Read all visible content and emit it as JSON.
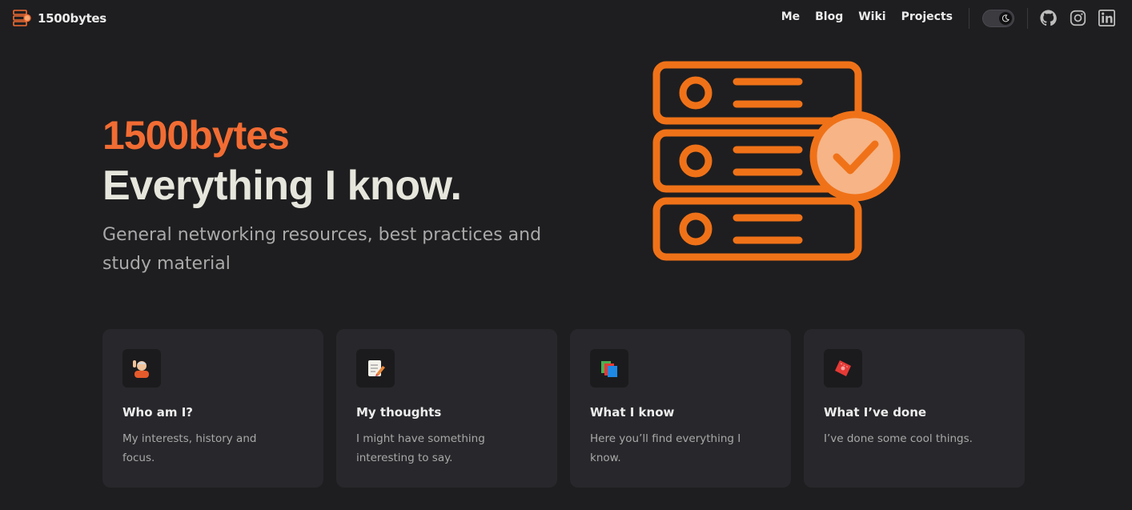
{
  "brand": {
    "name": "1500bytes",
    "accent": "#f26c33",
    "logo_icon": "server-stack-icon"
  },
  "nav": {
    "links": [
      {
        "label": "Me"
      },
      {
        "label": "Blog"
      },
      {
        "label": "Wiki"
      },
      {
        "label": "Projects"
      }
    ],
    "theme_toggle_icon": "moon-icon",
    "social": [
      "github-icon",
      "instagram-icon",
      "linkedin-icon"
    ]
  },
  "hero": {
    "brand": "1500bytes",
    "title": "Everything I know.",
    "subtitle": "General networking resources, best practices and study material",
    "illustration_icon": "server-check-icon"
  },
  "cards": [
    {
      "icon": "person-waving-emoji-icon",
      "title": "Who am I?",
      "desc": "My interests, history and focus."
    },
    {
      "icon": "memo-emoji-icon",
      "title": "My thoughts",
      "desc": "I might have something interesting to say."
    },
    {
      "icon": "books-emoji-icon",
      "title": "What I know",
      "desc": "Here you’ll find everything I know."
    },
    {
      "icon": "ticket-emoji-icon",
      "title": "What I’ve done",
      "desc": "I’ve done some cool things."
    }
  ]
}
